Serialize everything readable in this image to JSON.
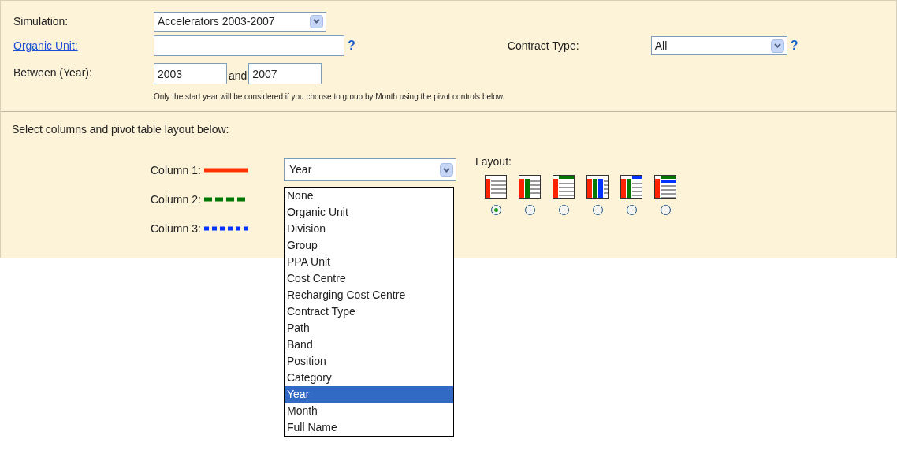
{
  "simulation": {
    "label": "Simulation:",
    "value": "Accelerators 2003-2007"
  },
  "organic_unit": {
    "label": "Organic Unit:",
    "help": "?"
  },
  "contract_type": {
    "label": "Contract Type:",
    "value": "All",
    "help": "?"
  },
  "between": {
    "label": "Between (Year):",
    "from": "2003",
    "joiner": "and",
    "to": "2007",
    "note": "Only the start year will be considered if you choose to group by Month using the pivot controls below."
  },
  "section_title": "Select columns and pivot table layout below:",
  "columns": [
    {
      "label": "Column 1:",
      "kind": "solid",
      "color": "#ff3300"
    },
    {
      "label": "Column 2:",
      "kind": "dashed",
      "color": "#007700"
    },
    {
      "label": "Column 3:",
      "kind": "dotted",
      "color": "#0033ff"
    }
  ],
  "column_1_select": {
    "value": "Year",
    "options": [
      {
        "label": "None",
        "selected": false
      },
      {
        "label": "Organic Unit",
        "selected": false
      },
      {
        "label": "Division",
        "selected": false
      },
      {
        "label": "Group",
        "selected": false
      },
      {
        "label": "PPA Unit",
        "selected": false
      },
      {
        "label": "Cost Centre",
        "selected": false
      },
      {
        "label": "Recharging Cost Centre",
        "selected": false
      },
      {
        "label": "Contract Type",
        "selected": false
      },
      {
        "label": "Path",
        "selected": false
      },
      {
        "label": "Band",
        "selected": false
      },
      {
        "label": "Position",
        "selected": false
      },
      {
        "label": "Category",
        "selected": false
      },
      {
        "label": "Year",
        "selected": true
      },
      {
        "label": "Month",
        "selected": false
      },
      {
        "label": "Full Name",
        "selected": false
      }
    ]
  },
  "layout": {
    "label": "Layout:",
    "options": [
      {
        "kind": "r1",
        "selected": true
      },
      {
        "kind": "r2",
        "selected": false
      },
      {
        "kind": "r1c1",
        "selected": false
      },
      {
        "kind": "r3",
        "selected": false
      },
      {
        "kind": "r2c1",
        "selected": false
      },
      {
        "kind": "r1c2",
        "selected": false
      }
    ]
  }
}
